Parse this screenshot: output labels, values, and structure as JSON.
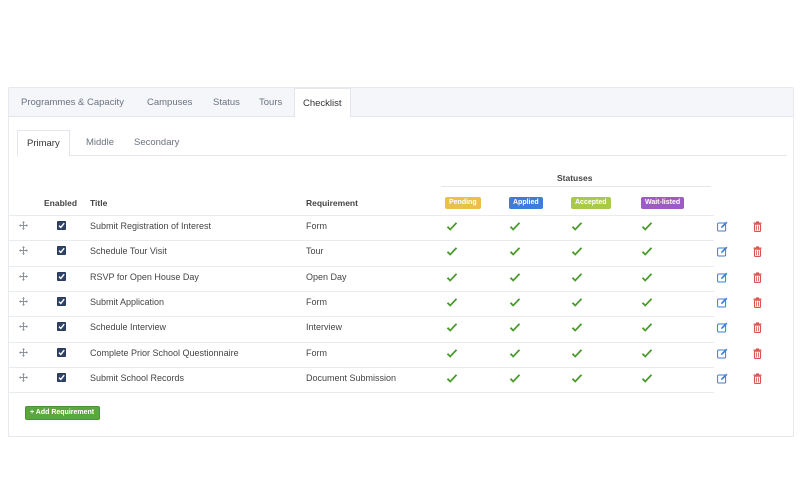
{
  "top_tabs": [
    {
      "label": "Programmes & Capacity",
      "active": false
    },
    {
      "label": "Campuses",
      "active": false
    },
    {
      "label": "Status",
      "active": false
    },
    {
      "label": "Tours",
      "active": false
    },
    {
      "label": "Checklist",
      "active": true
    }
  ],
  "sub_tabs": [
    {
      "label": "Primary",
      "active": true
    },
    {
      "label": "Middle",
      "active": false
    },
    {
      "label": "Secondary",
      "active": false
    }
  ],
  "table": {
    "statuses_header": "Statuses",
    "columns": {
      "enabled": "Enabled",
      "title": "Title",
      "requirement": "Requirement"
    },
    "status_badges": [
      {
        "label": "Pending",
        "color": "#e8c14a"
      },
      {
        "label": "Applied",
        "color": "#3b7dd8"
      },
      {
        "label": "Accepted",
        "color": "#a9c94a"
      },
      {
        "label": "Wait-listed",
        "color": "#9c5bc7"
      }
    ],
    "rows": [
      {
        "enabled": true,
        "title": "Submit Registration of Interest",
        "requirement": "Form"
      },
      {
        "enabled": true,
        "title": "Schedule Tour Visit",
        "requirement": "Tour"
      },
      {
        "enabled": true,
        "title": "RSVP for Open House Day",
        "requirement": "Open Day"
      },
      {
        "enabled": true,
        "title": "Submit Application",
        "requirement": "Form"
      },
      {
        "enabled": true,
        "title": "Schedule Interview",
        "requirement": "Interview"
      },
      {
        "enabled": true,
        "title": "Complete Prior School Questionnaire",
        "requirement": "Form"
      },
      {
        "enabled": true,
        "title": "Submit School Records",
        "requirement": "Document Submission"
      }
    ]
  },
  "add_button": {
    "icon": "plus-icon",
    "label": "+ Add Requirement"
  },
  "colors": {
    "check": "#4a9a2e",
    "edit": "#3b7dd8",
    "delete": "#d9534f",
    "add_button": "#5aa83d"
  },
  "icons": {
    "drag": "move-icon",
    "edit": "edit-icon",
    "delete": "trash-icon",
    "status": "checkmark-icon"
  }
}
